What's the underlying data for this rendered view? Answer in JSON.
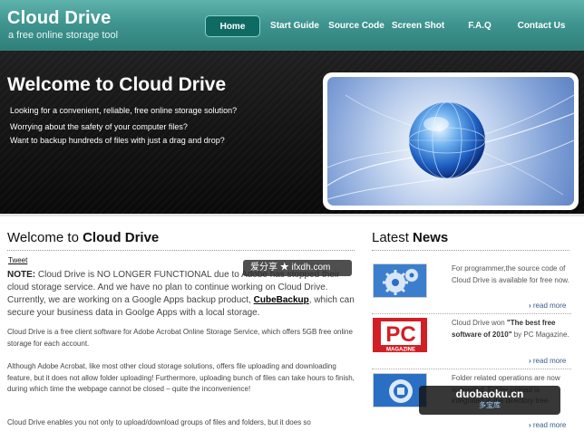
{
  "header": {
    "logo_title": "Cloud Drive",
    "logo_subtitle": "a free online storage tool",
    "nav": [
      "Home",
      "Start Guide",
      "Source Code",
      "Screen Shot",
      "F.A.Q",
      "Contact Us"
    ],
    "active_nav": "Home"
  },
  "hero": {
    "title": "Welcome to Cloud Drive",
    "lines": [
      "Looking for a convenient, reliable, free online storage solution?",
      "Worrying about the safety of your computer files?",
      "Want to backup hundreds of files with just a drag and drop?"
    ]
  },
  "main": {
    "heading_prefix": "Welcome to ",
    "heading_bold": "Cloud Drive",
    "tweet_label": "Tweet",
    "note_label": "NOTE:",
    "note_text_1": " Cloud Drive is NO LONGER FUNCTIONAL due to Adobe has stopped their cloud storage service. And we have no plan to continue working on Cloud Drive. Currently, we are working on a Google Apps backup product, ",
    "note_link": "CubeBackup",
    "note_text_2": ", which can secure your business data in Goolge Apps with a local storage.",
    "para2": "Cloud Drive is a free client software for Adobe Acrobat Online Storage Service, which offers 5GB free online storage for each account.",
    "para3": "Although Adobe Acrobat, like most other cloud storage solutions, offers file uploading and downloading feature, but it does not allow folder uploading! Furthermore, uploading bunch of files can take hours to finish, during which time the webpage cannot be closed – quite the inconvenience!",
    "para4": "Cloud Drive enables you not only to upload/download groups of files and folders, but it does so"
  },
  "news": {
    "heading_prefix": "Latest ",
    "heading_bold": "News",
    "read_more": "read more",
    "items": [
      {
        "text": "For programmer,the source code of Cloud Drive is available for free now."
      },
      {
        "text_before": "Cloud Drive won ",
        "bold": "\"The best free software of 2010\"",
        "text_after": " by PC Magazine."
      },
      {
        "text": "Folder related operations are now supported. Folder upload is integrated in the directory tree."
      }
    ]
  },
  "watermarks": {
    "top": "爱分享 ★ ifxdh.com",
    "bottom_main": "duobaoku.cn",
    "bottom_sub": "多宝库"
  },
  "colors": {
    "header_teal": "#3f9590",
    "nav_active": "#0f6a64",
    "hero_dark": "#141414",
    "pc_red": "#d21f26"
  }
}
